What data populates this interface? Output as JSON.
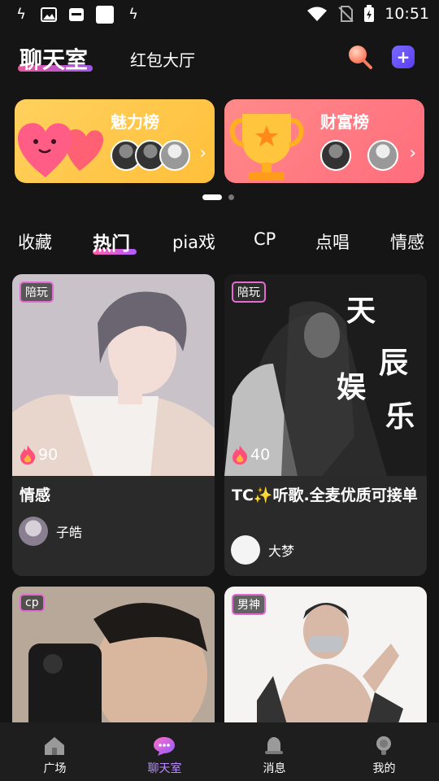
{
  "status_bar": {
    "time": "10:51"
  },
  "header": {
    "active_tab": "聊天室",
    "other_tab": "红包大厅"
  },
  "banners": [
    {
      "title": "魅力榜"
    },
    {
      "title": "财富榜"
    }
  ],
  "categories": [
    "收藏",
    "热门",
    "pia戏",
    "CP",
    "点唱",
    "情感"
  ],
  "active_category": "热门",
  "rooms": [
    {
      "tag": "陪玩",
      "heat": "90",
      "title": "情感",
      "owner": "子皓"
    },
    {
      "tag": "陪玩",
      "heat": "40",
      "title": "TC✨听歌.全麦优质可接单",
      "owner": "大梦",
      "art_text": [
        "天",
        "辰",
        "娱",
        "乐"
      ]
    },
    {
      "tag": "cp"
    },
    {
      "tag": "男神"
    }
  ],
  "bottom_nav": [
    {
      "label": "广场",
      "icon": "house-icon"
    },
    {
      "label": "聊天室",
      "icon": "chat-bubble-icon"
    },
    {
      "label": "消息",
      "icon": "bell-icon"
    },
    {
      "label": "我的",
      "icon": "lightbulb-icon"
    }
  ],
  "colors": {
    "background": "#151515",
    "accent_pink": "#ff5fa8",
    "accent_purple": "#b05cff",
    "charm_banner": "#ffc94a",
    "wealth_banner": "#ff7a82",
    "tag_border": "#e46ad3",
    "nav_active": "#b78bff"
  }
}
